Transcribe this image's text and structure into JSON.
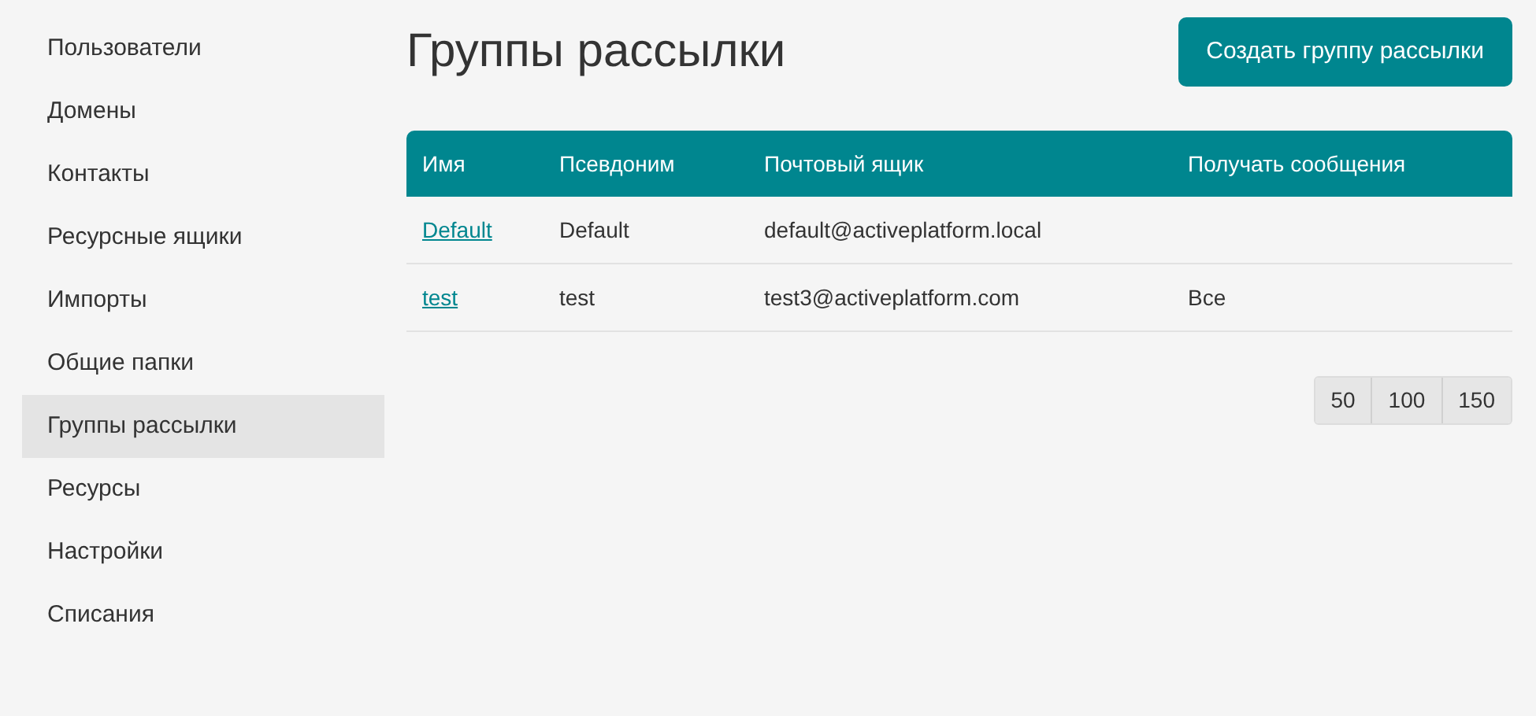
{
  "sidebar": {
    "items": [
      {
        "label": "Пользователи",
        "selected": false
      },
      {
        "label": "Домены",
        "selected": false
      },
      {
        "label": "Контакты",
        "selected": false
      },
      {
        "label": "Ресурсные ящики",
        "selected": false
      },
      {
        "label": "Импорты",
        "selected": false
      },
      {
        "label": "Общие папки",
        "selected": false
      },
      {
        "label": "Группы рассылки",
        "selected": true
      },
      {
        "label": "Ресурсы",
        "selected": false
      },
      {
        "label": "Настройки",
        "selected": false
      },
      {
        "label": "Списания",
        "selected": false
      }
    ]
  },
  "page": {
    "title": "Группы рассылки",
    "create_button": "Создать группу рассылки"
  },
  "table": {
    "columns": [
      "Имя",
      "Псевдоним",
      "Почтовый ящик",
      "Получать сообщения"
    ],
    "rows": [
      {
        "name": "Default",
        "alias": "Default",
        "mailbox": "default@activeplatform.local"
      },
      {
        "name": "test",
        "alias": "test",
        "mailbox": "test3@activeplatform.com",
        "receive": "Все"
      }
    ]
  },
  "pagination": [
    "50",
    "100",
    "150"
  ]
}
